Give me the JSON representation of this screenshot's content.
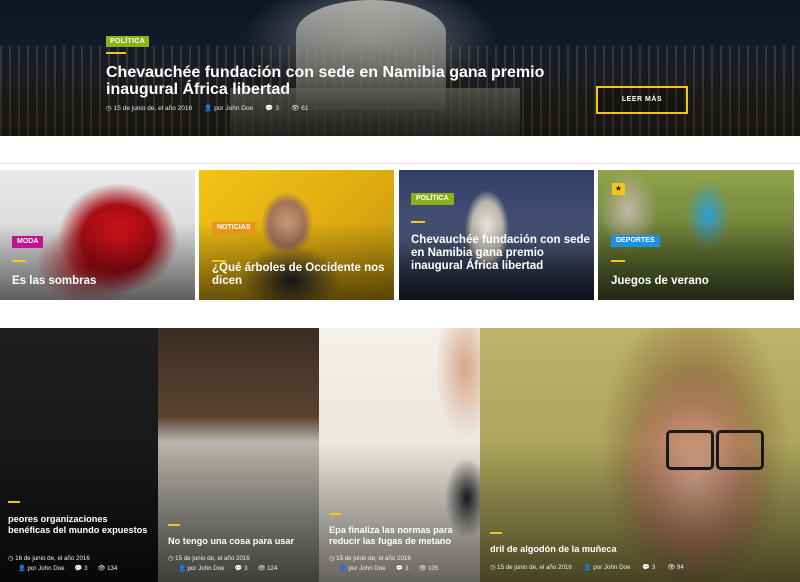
{
  "hero": {
    "category": "POLÍTICA",
    "title": "Chevauchée fundación con sede en Namibia gana premio inaugural África libertad",
    "date": "15 de junio de, el año 2016",
    "author": "por John Doe",
    "comments": "3",
    "views": "61",
    "button_label": "LEER MÁS"
  },
  "cards": [
    {
      "category": "MODA",
      "category_color": "#c3128b",
      "title": "Es las sombras"
    },
    {
      "category": "NOTICIAS",
      "category_color": "#e8941a",
      "title": "¿Qué árboles de Occidente nos dicen"
    },
    {
      "category": "POLÍTICA",
      "category_color": "#8cb11a",
      "title": "Chevauchée fundación con sede en Namibia gana premio inaugural África libertad"
    },
    {
      "category": "DEPORTES",
      "category_color": "#1e90e0",
      "title": "Juegos de verano",
      "badge": "★"
    }
  ],
  "bottom": [
    {
      "title": "peores organizaciones benéficas del mundo expuestos",
      "date": "16 de junio de, el año 2016",
      "author": "por John Doe",
      "comments": "3",
      "views": "134"
    },
    {
      "title": "No tengo una cosa para usar",
      "date": "15 de junio de, el año 2016",
      "author": "por John Doe",
      "comments": "3",
      "views": "124"
    },
    {
      "title": "Epa finaliza las normas para reducir las fugas de metano",
      "date": "15 de junio de, el año 2016",
      "author": "por John Doe",
      "comments": "3",
      "views": "105"
    },
    {
      "title": "dril de algodón de la muñeca",
      "date": "15 de junio de, el año 2016",
      "author": "por John Doe",
      "comments": "3",
      "views": "94"
    }
  ],
  "icons": {
    "clock": "◷",
    "user": "👤",
    "comment": "💬",
    "eye": "👁"
  },
  "colors": {
    "accent": "#f5c518"
  }
}
